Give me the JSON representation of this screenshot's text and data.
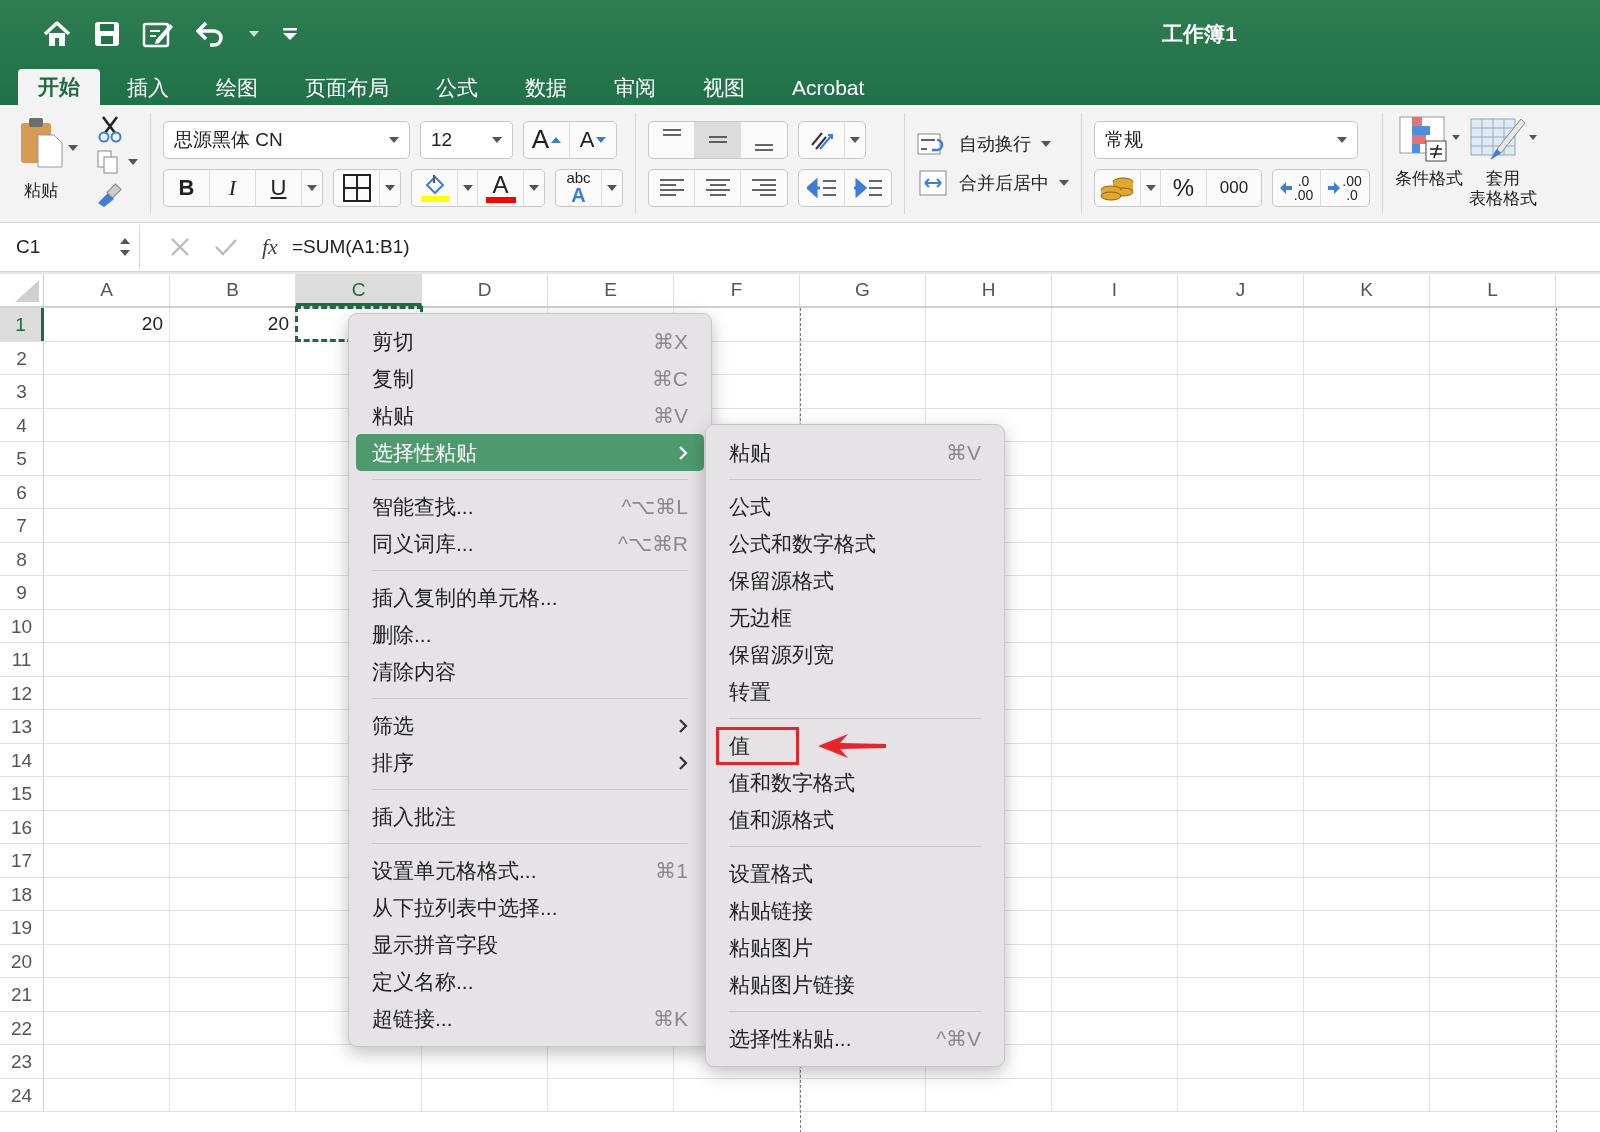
{
  "window": {
    "title": "工作簿1"
  },
  "tabs": [
    {
      "label": "开始",
      "selected": true
    },
    {
      "label": "插入",
      "selected": false
    },
    {
      "label": "绘图",
      "selected": false
    },
    {
      "label": "页面布局",
      "selected": false
    },
    {
      "label": "公式",
      "selected": false
    },
    {
      "label": "数据",
      "selected": false
    },
    {
      "label": "审阅",
      "selected": false
    },
    {
      "label": "视图",
      "selected": false
    },
    {
      "label": "Acrobat",
      "selected": false
    }
  ],
  "ribbon": {
    "paste_label": "粘贴",
    "font_name": "思源黑体 CN",
    "font_size": "12",
    "grow_font": "A",
    "shrink_font": "A",
    "bold": "B",
    "italic": "I",
    "underline": "U",
    "font_color": "A",
    "phonetic_top": "abc",
    "phonetic_letter": "A",
    "wrap_text": "自动换行",
    "merge_center": "合并后居中",
    "number_format": "常规",
    "percent": "%",
    "thousands": "000",
    "decimal_increase": [
      ".0",
      ".00"
    ],
    "decimal_decrease": [
      ".00",
      ".0"
    ],
    "conditional_format": "条件格式",
    "table_format": [
      "套用",
      "表格格式"
    ]
  },
  "formula_bar": {
    "name_box": "C1",
    "fx": "fx",
    "formula": "=SUM(A1:B1)"
  },
  "columns": [
    {
      "label": "A",
      "selected": false,
      "page_break": false
    },
    {
      "label": "B",
      "selected": false,
      "page_break": false
    },
    {
      "label": "C",
      "selected": true,
      "page_break": false
    },
    {
      "label": "D",
      "selected": false,
      "page_break": false
    },
    {
      "label": "E",
      "selected": false,
      "page_break": false
    },
    {
      "label": "F",
      "selected": false,
      "page_break": true
    },
    {
      "label": "G",
      "selected": false,
      "page_break": false
    },
    {
      "label": "H",
      "selected": false,
      "page_break": false
    },
    {
      "label": "I",
      "selected": false,
      "page_break": false
    },
    {
      "label": "J",
      "selected": false,
      "page_break": false
    },
    {
      "label": "K",
      "selected": false,
      "page_break": false
    },
    {
      "label": "L",
      "selected": false,
      "page_break": true
    }
  ],
  "rows": [
    {
      "label": "1",
      "selected": true,
      "cells": [
        "20",
        "20"
      ]
    },
    {
      "label": "2",
      "selected": false
    },
    {
      "label": "3",
      "selected": false
    },
    {
      "label": "4",
      "selected": false
    },
    {
      "label": "5",
      "selected": false
    },
    {
      "label": "6",
      "selected": false
    },
    {
      "label": "7",
      "selected": false
    },
    {
      "label": "8",
      "selected": false
    },
    {
      "label": "9",
      "selected": false
    },
    {
      "label": "10",
      "selected": false
    },
    {
      "label": "11",
      "selected": false
    },
    {
      "label": "12",
      "selected": false
    },
    {
      "label": "13",
      "selected": false
    },
    {
      "label": "14",
      "selected": false
    },
    {
      "label": "15",
      "selected": false
    },
    {
      "label": "16",
      "selected": false
    },
    {
      "label": "17",
      "selected": false
    },
    {
      "label": "18",
      "selected": false
    },
    {
      "label": "19",
      "selected": false
    },
    {
      "label": "20",
      "selected": false
    },
    {
      "label": "21",
      "selected": false
    },
    {
      "label": "22",
      "selected": false
    },
    {
      "label": "23",
      "selected": false
    },
    {
      "label": "24",
      "selected": false
    }
  ],
  "context_menu": [
    {
      "kind": "item",
      "label": "剪切",
      "shortcut": "⌘X"
    },
    {
      "kind": "item",
      "label": "复制",
      "shortcut": "⌘C"
    },
    {
      "kind": "item",
      "label": "粘贴",
      "shortcut": "⌘V"
    },
    {
      "kind": "submenu",
      "label": "选择性粘贴",
      "selected": true
    },
    {
      "kind": "separator"
    },
    {
      "kind": "item",
      "label": "智能查找...",
      "shortcut": "^⌥⌘L"
    },
    {
      "kind": "item",
      "label": "同义词库...",
      "shortcut": "^⌥⌘R"
    },
    {
      "kind": "separator"
    },
    {
      "kind": "item",
      "label": "插入复制的单元格..."
    },
    {
      "kind": "item",
      "label": "删除..."
    },
    {
      "kind": "item",
      "label": "清除内容"
    },
    {
      "kind": "separator"
    },
    {
      "kind": "submenu",
      "label": "筛选",
      "selected": false
    },
    {
      "kind": "submenu",
      "label": "排序",
      "selected": false
    },
    {
      "kind": "separator"
    },
    {
      "kind": "item",
      "label": "插入批注"
    },
    {
      "kind": "separator"
    },
    {
      "kind": "item",
      "label": "设置单元格格式...",
      "shortcut": "⌘1"
    },
    {
      "kind": "item",
      "label": "从下拉列表中选择..."
    },
    {
      "kind": "item",
      "label": "显示拼音字段"
    },
    {
      "kind": "item",
      "label": "定义名称..."
    },
    {
      "kind": "item",
      "label": "超链接...",
      "shortcut": "⌘K"
    }
  ],
  "paste_special_menu": [
    {
      "kind": "item",
      "label": "粘贴",
      "shortcut": "⌘V",
      "annotated": false
    },
    {
      "kind": "separator"
    },
    {
      "kind": "item",
      "label": "公式",
      "annotated": false
    },
    {
      "kind": "item",
      "label": "公式和数字格式",
      "annotated": false
    },
    {
      "kind": "item",
      "label": "保留源格式",
      "annotated": false
    },
    {
      "kind": "item",
      "label": "无边框",
      "annotated": false
    },
    {
      "kind": "item",
      "label": "保留源列宽",
      "annotated": false
    },
    {
      "kind": "item",
      "label": "转置",
      "annotated": false
    },
    {
      "kind": "separator"
    },
    {
      "kind": "item",
      "label": "值",
      "annotated": true
    },
    {
      "kind": "item",
      "label": "值和数字格式",
      "annotated": false
    },
    {
      "kind": "item",
      "label": "值和源格式",
      "annotated": false
    },
    {
      "kind": "separator"
    },
    {
      "kind": "item",
      "label": "设置格式",
      "annotated": false
    },
    {
      "kind": "item",
      "label": "粘贴链接",
      "annotated": false
    },
    {
      "kind": "item",
      "label": "粘贴图片",
      "annotated": false
    },
    {
      "kind": "item",
      "label": "粘贴图片链接",
      "annotated": false
    },
    {
      "kind": "separator"
    },
    {
      "kind": "item",
      "label": "选择性粘贴...",
      "shortcut": "^⌘V",
      "annotated": false
    }
  ]
}
